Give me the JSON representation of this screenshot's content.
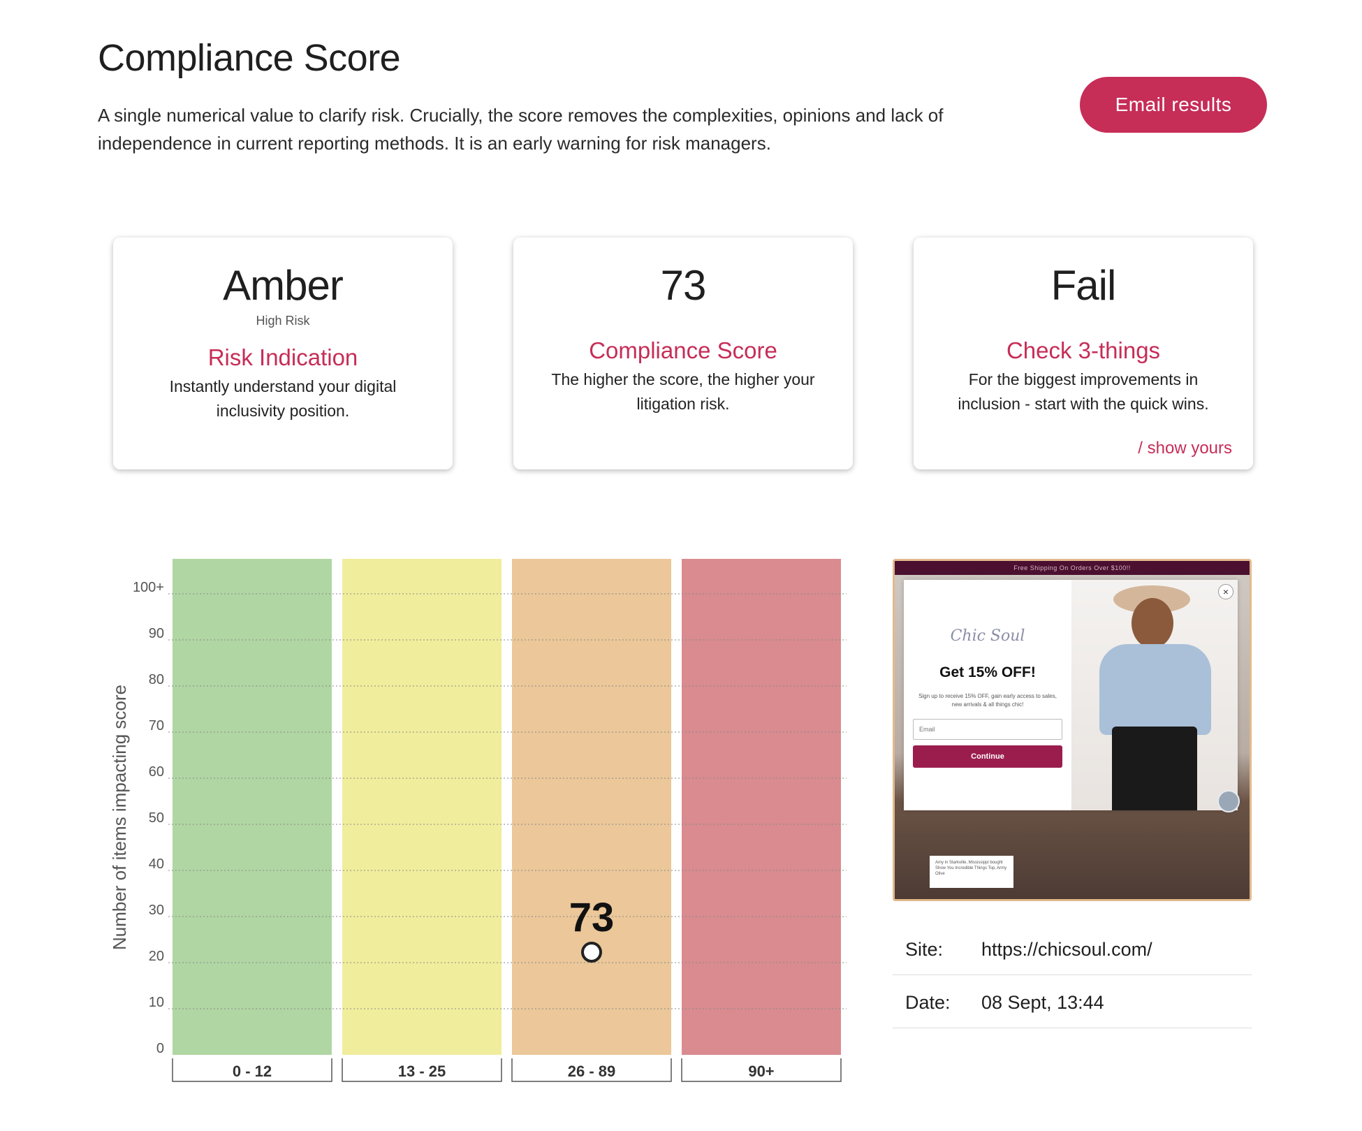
{
  "header": {
    "title": "Compliance Score",
    "description": "A single numerical value to clarify risk. Crucially, the score removes the complexities, opinions and lack of independence in current reporting methods. It is an early warning for risk managers.",
    "email_button": "Email results"
  },
  "cards": [
    {
      "big": "Amber",
      "sub": "High Risk",
      "heading": "Risk Indication",
      "text": "Instantly understand your digital inclusivity position."
    },
    {
      "big": "73",
      "heading": "Compliance Score",
      "text": "The higher the score, the higher your litigation risk."
    },
    {
      "big": "Fail",
      "heading": "Check 3-things",
      "text": "For the biggest improvements in inclusion - start with the quick wins.",
      "link": "/ show yours"
    }
  ],
  "chart_data": {
    "type": "bar",
    "categories": [
      "0 - 12",
      "13 - 25",
      "26 - 89",
      "90+"
    ],
    "band_colors": [
      "#b0d6a3",
      "#f0ed9c",
      "#ebc799",
      "#d98b8f"
    ],
    "ylabel": "Number of items impacting score",
    "yticks": [
      "0",
      "10",
      "20",
      "30",
      "40",
      "50",
      "60",
      "70",
      "80",
      "90",
      "100+"
    ],
    "ylim": [
      0,
      100
    ],
    "grid": true,
    "marker": {
      "category": "26 - 89",
      "value": 20,
      "label": "73"
    }
  },
  "preview": {
    "banner": "Free Shipping On Orders Over $100!!",
    "logo": "Chic Soul",
    "offer": "Get 15% OFF!",
    "note": "Sign up to receive 15% OFF, gain early access to sales, new arrivals & all things chic!",
    "email_placeholder": "Email",
    "continue": "Continue",
    "review": "Amy in Starkville, Mississippi bought Show You Incredible Things Top, Army Olive"
  },
  "info": {
    "site_label": "Site:",
    "site_value": "https://chicsoul.com/",
    "date_label": "Date:",
    "date_value": "08 Sept, 13:44"
  }
}
